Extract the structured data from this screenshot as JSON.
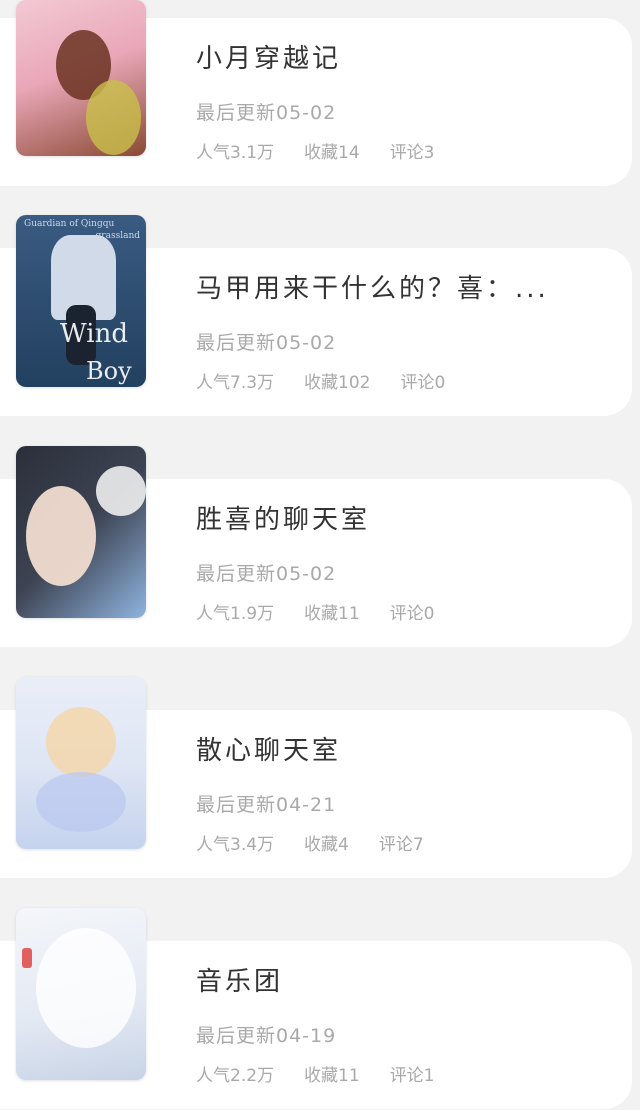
{
  "books": [
    {
      "title": "小月穿越记",
      "updated": "最后更新05-02",
      "popularity": "人气3.1万",
      "favorites": "收藏14",
      "comments": "评论3",
      "cover_colors": [
        "#e9a7b8",
        "#7a3b2a",
        "#c9c04a"
      ]
    },
    {
      "title": "马甲用来干什么的？喜：...",
      "updated": "最后更新05-02",
      "popularity": "人气7.3万",
      "favorites": "收藏102",
      "comments": "评论0",
      "cover_colors": [
        "#2c4a6e",
        "#d9e2ef",
        "#5b7fa8"
      ],
      "cover_text": [
        "Guardian of Qingqu",
        "grassland",
        "Wind",
        "Boy"
      ]
    },
    {
      "title": "胜喜的聊天室",
      "updated": "最后更新05-02",
      "popularity": "人气1.9万",
      "favorites": "收藏11",
      "comments": "评论0",
      "cover_colors": [
        "#2b2f3a",
        "#f1dcd0",
        "#8fb4e0"
      ]
    },
    {
      "title": "散心聊天室",
      "updated": "最后更新04-21",
      "popularity": "人气3.4万",
      "favorites": "收藏4",
      "comments": "评论7",
      "cover_colors": [
        "#dfe6f4",
        "#f5d6a8",
        "#b9c8ef"
      ]
    },
    {
      "title": "音乐团",
      "updated": "最后更新04-19",
      "popularity": "人气2.2万",
      "favorites": "收藏11",
      "comments": "评论1",
      "cover_colors": [
        "#eef1f6",
        "#c7d3e6",
        "#f2c4c4"
      ]
    }
  ]
}
